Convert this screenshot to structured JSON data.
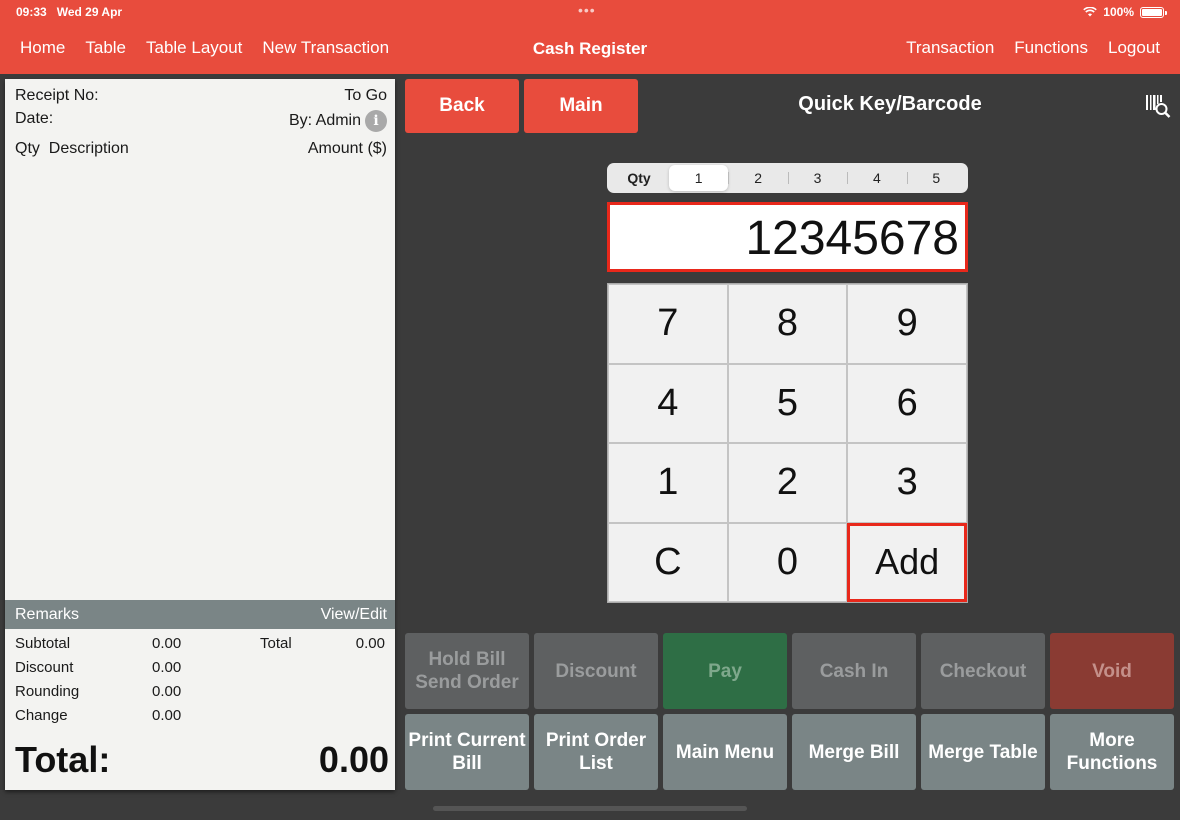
{
  "status": {
    "time": "09:33",
    "date": "Wed 29 Apr",
    "battery": "100%"
  },
  "nav": {
    "left": [
      "Home",
      "Table",
      "Table Layout",
      "New Transaction"
    ],
    "title": "Cash Register",
    "right": [
      "Transaction",
      "Functions",
      "Logout"
    ]
  },
  "receipt": {
    "receipt_no_label": "Receipt No:",
    "order_type": "To Go",
    "date_label": "Date:",
    "by_label": "By: Admin",
    "col_qty": "Qty",
    "col_desc": "Description",
    "col_amount": "Amount ($)",
    "remarks_label": "Remarks",
    "remarks_action": "View/Edit",
    "subtotal_label": "Subtotal",
    "subtotal": "0.00",
    "total_label": "Total",
    "total": "0.00",
    "discount_label": "Discount",
    "discount": "0.00",
    "rounding_label": "Rounding",
    "rounding": "0.00",
    "change_label": "Change",
    "change": "0.00",
    "grand_total_label": "Total:",
    "grand_total": "0.00"
  },
  "actions": {
    "back": "Back",
    "main": "Main",
    "panel_title": "Quick Key/Barcode"
  },
  "qty": {
    "label": "Qty",
    "options": [
      "1",
      "2",
      "3",
      "4",
      "5"
    ],
    "selected": "1"
  },
  "display": {
    "value": "12345678"
  },
  "keypad": [
    "7",
    "8",
    "9",
    "4",
    "5",
    "6",
    "1",
    "2",
    "3",
    "C",
    "0",
    "Add"
  ],
  "functions": {
    "hold_bill": "Hold Bill",
    "send_order": "Send Order",
    "discount": "Discount",
    "pay": "Pay",
    "cash_in": "Cash In",
    "checkout": "Checkout",
    "void": "Void",
    "print_current_1": "Print Current",
    "print_current_2": "Bill",
    "print_order_1": "Print Order",
    "print_order_2": "List",
    "main_menu": "Main Menu",
    "merge_bill": "Merge Bill",
    "merge_table": "Merge Table",
    "more_1": "More",
    "more_2": "Functions"
  },
  "colors": {
    "brand": "#e84c3d",
    "pay": "#2e6e45",
    "void": "#8a3b33",
    "highlight": "#e8281b"
  }
}
